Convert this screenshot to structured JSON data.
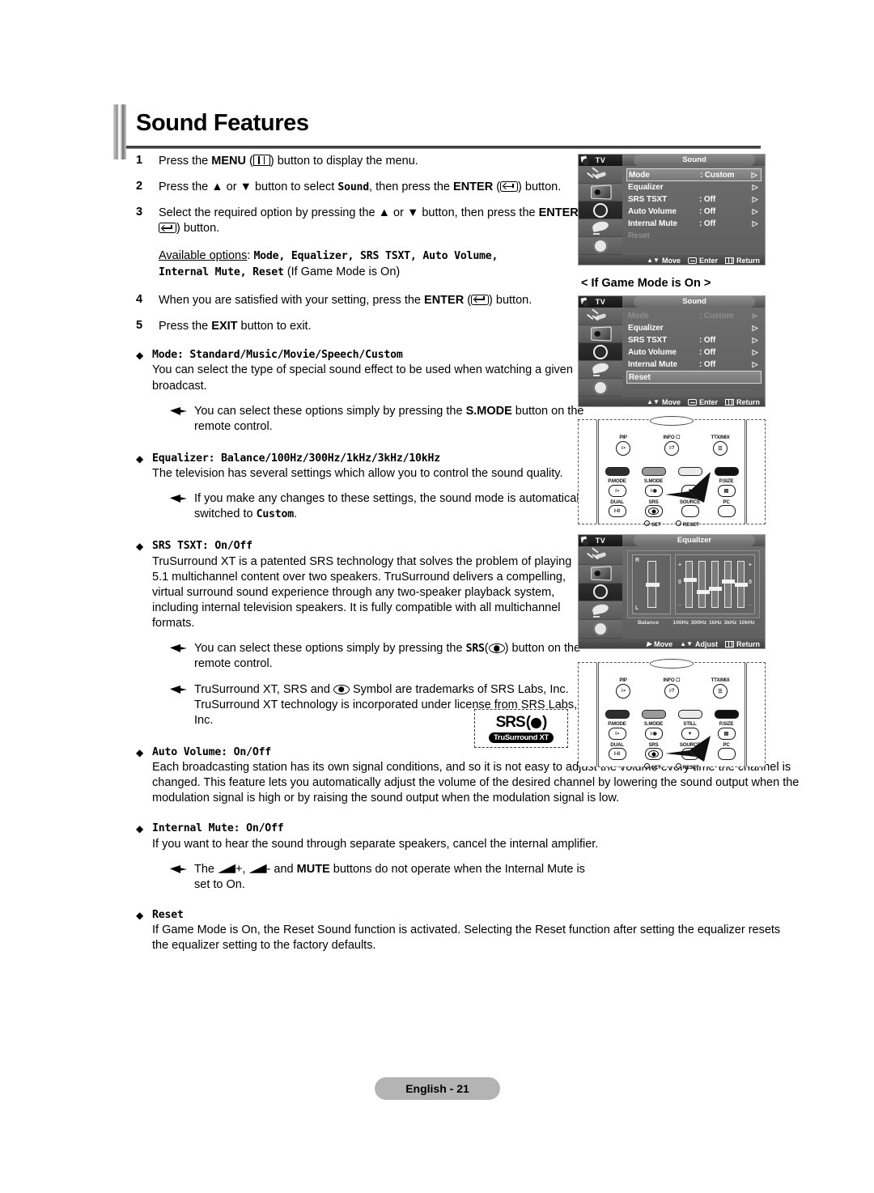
{
  "page": {
    "title": "Sound Features",
    "footer": "English - 21"
  },
  "steps": [
    {
      "num": "1",
      "text_before": "Press the ",
      "bold1": "MENU",
      "mid": " (",
      "icon": "menu-icon",
      "text_after": ") button to display the menu."
    },
    {
      "num": "2",
      "text_before": "Press the ▲ or ▼ button to select ",
      "mono1": "Sound",
      "mid": ", then press the ",
      "bold1": "ENTER",
      "mid2": " (",
      "icon": "enter-icon",
      "text_after": ") button."
    },
    {
      "num": "3",
      "text_before": "Select the required option by pressing the ▲ or ▼ button, then press the ",
      "bold1": "ENTER",
      "mid": " (",
      "icon": "enter-icon",
      "text_after": ") button."
    },
    {
      "num": "4",
      "text_before": "When you are satisfied with your setting, press the ",
      "bold1": "ENTER",
      "mid": " (",
      "icon": "enter-icon",
      "text_after": ") button."
    },
    {
      "num": "5",
      "text_before": "Press the ",
      "bold1": "EXIT",
      "text_after": " button to exit."
    }
  ],
  "available": {
    "label": "Available options",
    "colon": ": ",
    "options": "Mode, Equalizer, SRS TSXT, Auto Volume,",
    "options2": "Internal Mute, Reset",
    "suffix": " (If Game Mode is On)"
  },
  "bullets": [
    {
      "title": "Mode: Standard/Music/Movie/Speech/Custom",
      "para": "You can select the type of special sound effect to be used when watching a given broadcast.",
      "notes": [
        {
          "pre": "You can select these options simply by pressing the ",
          "bold": "S.MODE",
          "post": " button on the remote control."
        }
      ]
    },
    {
      "title": "Equalizer: Balance/100Hz/300Hz/1kHz/3kHz/10kHz",
      "para": "The television has several settings which allow you to control the sound quality.",
      "notes": [
        {
          "pre": "If you make any changes to these settings, the sound mode is automatically switched to ",
          "mono": "Custom",
          "post": "."
        }
      ]
    },
    {
      "title": "SRS TSXT: On/Off",
      "para": "TruSurround XT is a patented SRS technology that solves the problem of playing 5.1 multichannel content over two speakers. TruSurround delivers a compelling, virtual surround sound experience through any two-speaker playback system, including internal television speakers. It is fully compatible with all multichannel formats.",
      "notes": [
        {
          "pre": "You can select these options simply by pressing the ",
          "monoSRS": "SRS",
          "paren_open": "(",
          "icon": "srs-symbol-icon",
          "paren_close": ")",
          "post": " button on the remote control."
        },
        {
          "pre": "TruSurround XT, SRS and ",
          "icon": "srs-symbol-icon",
          "post": " Symbol are trademarks of SRS Labs, Inc. TruSurround XT technology is incorporated under license from SRS Labs, Inc."
        }
      ]
    },
    {
      "title": "Auto Volume: On/Off",
      "para": "Each broadcasting station has its own signal conditions, and so it is not easy to adjust the volume every time the channel is changed. This feature lets you automatically adjust the volume of the desired channel by lowering the sound output when the modulation signal is high or by raising the sound output when the modulation signal is low.",
      "notes": []
    },
    {
      "title": "Internal Mute: On/Off",
      "para": "If you want to hear the sound through separate speakers, cancel the internal amplifier.",
      "notes": [
        {
          "pre": "The ",
          "volplus": "+,",
          "volminus": "- and ",
          "bold": "MUTE",
          "post": " buttons do not operate when the Internal Mute is set to On."
        }
      ]
    },
    {
      "title": "Reset",
      "para": "If Game Mode is On, the Reset Sound function is activated. Selecting the Reset function after setting the equalizer resets the equalizer setting to the factory defaults.",
      "notes": []
    }
  ],
  "srs_logo": {
    "brand": "SRS",
    "sub": "TruSurround XT"
  },
  "game_mode_label": "< If Game Mode is On >",
  "osd": {
    "tv_label": "TV",
    "footer": {
      "move": "Move",
      "enter": "Enter",
      "return": "Return",
      "adjust": "Adjust"
    },
    "sound_menu": {
      "title": "Sound",
      "rows": [
        {
          "label": "Mode",
          "value": ": Custom",
          "caret": "▷",
          "state": "highlight"
        },
        {
          "label": "Equalizer",
          "value": "",
          "caret": "▷",
          "state": "normal"
        },
        {
          "label": "SRS TSXT",
          "value": ": Off",
          "caret": "▷",
          "state": "normal"
        },
        {
          "label": "Auto Volume",
          "value": ": Off",
          "caret": "▷",
          "state": "normal"
        },
        {
          "label": "Internal Mute",
          "value": ": Off",
          "caret": "▷",
          "state": "normal"
        },
        {
          "label": "Reset",
          "value": "",
          "caret": "",
          "state": "dim"
        }
      ]
    },
    "sound_menu_gamemode": {
      "title": "Sound",
      "rows": [
        {
          "label": "Mode",
          "value": ": Custom",
          "caret": "▶",
          "state": "dim"
        },
        {
          "label": "Equalizer",
          "value": "",
          "caret": "▷",
          "state": "normal"
        },
        {
          "label": "SRS TSXT",
          "value": ": Off",
          "caret": "▷",
          "state": "normal"
        },
        {
          "label": "Auto Volume",
          "value": ": Off",
          "caret": "▷",
          "state": "normal"
        },
        {
          "label": "Internal Mute",
          "value": ": Off",
          "caret": "▷",
          "state": "normal"
        },
        {
          "label": "Reset",
          "value": "",
          "caret": "",
          "state": "highlight"
        }
      ]
    },
    "equalizer_menu": {
      "title": "Equalizer",
      "balance_label": "Balance",
      "r_label": "R",
      "l_label": "L",
      "plus": "+",
      "zero": "0",
      "minus": "_",
      "bands": [
        {
          "label": "100Hz",
          "level": 1
        },
        {
          "label": "300Hz",
          "level": -1
        },
        {
          "label": "1kHz",
          "level": -0.5
        },
        {
          "label": "3kHz",
          "level": 0.8
        },
        {
          "label": "10kHz",
          "level": 0.2
        }
      ],
      "balance_level": 0
    }
  },
  "remote": {
    "top_labels": [
      "PIP",
      "INFO",
      "TTX/MIX"
    ],
    "mid_labels": [
      "P.MODE",
      "S.MODE",
      "STILL",
      "P.SIZE"
    ],
    "bottom_labels": [
      "DUAL",
      "SRS",
      "SOURCE",
      "PC"
    ],
    "dual_text": "I-II",
    "set": "SET",
    "reset": "RESET",
    "callout_1": "S.MODE",
    "callout_2": "SRS"
  }
}
